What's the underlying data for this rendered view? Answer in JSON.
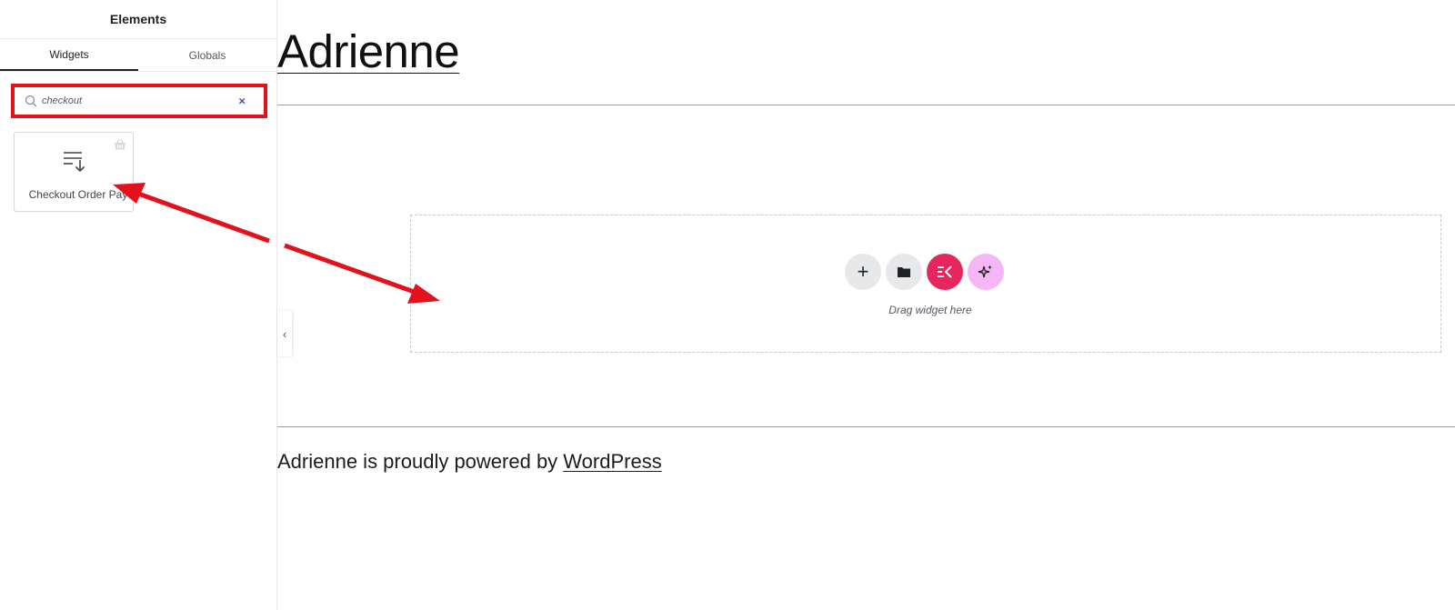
{
  "panel": {
    "title": "Elements",
    "tabs": [
      {
        "label": "Widgets",
        "active": true
      },
      {
        "label": "Globals",
        "active": false
      }
    ],
    "search": {
      "value": "checkout",
      "clear_label": "×"
    },
    "widgets": [
      {
        "label": "Checkout Order Pay",
        "icon": "list-sort-icon",
        "badge_icon": "basket-icon"
      }
    ],
    "collapse_label": "‹"
  },
  "canvas": {
    "site_title": "Adrienne",
    "dropzone": {
      "add_label": "+",
      "hint": "Drag widget here"
    },
    "footer": {
      "prefix": "Adrienne is proudly powered by ",
      "link": "WordPress"
    }
  },
  "annotation": {
    "highlight_color": "#e3111b",
    "arrow_color": "#e3111b"
  },
  "colors": {
    "kit_button": "#e8255f",
    "ai_button": "#f5b6f5",
    "clear_icon": "#3f51b5"
  }
}
